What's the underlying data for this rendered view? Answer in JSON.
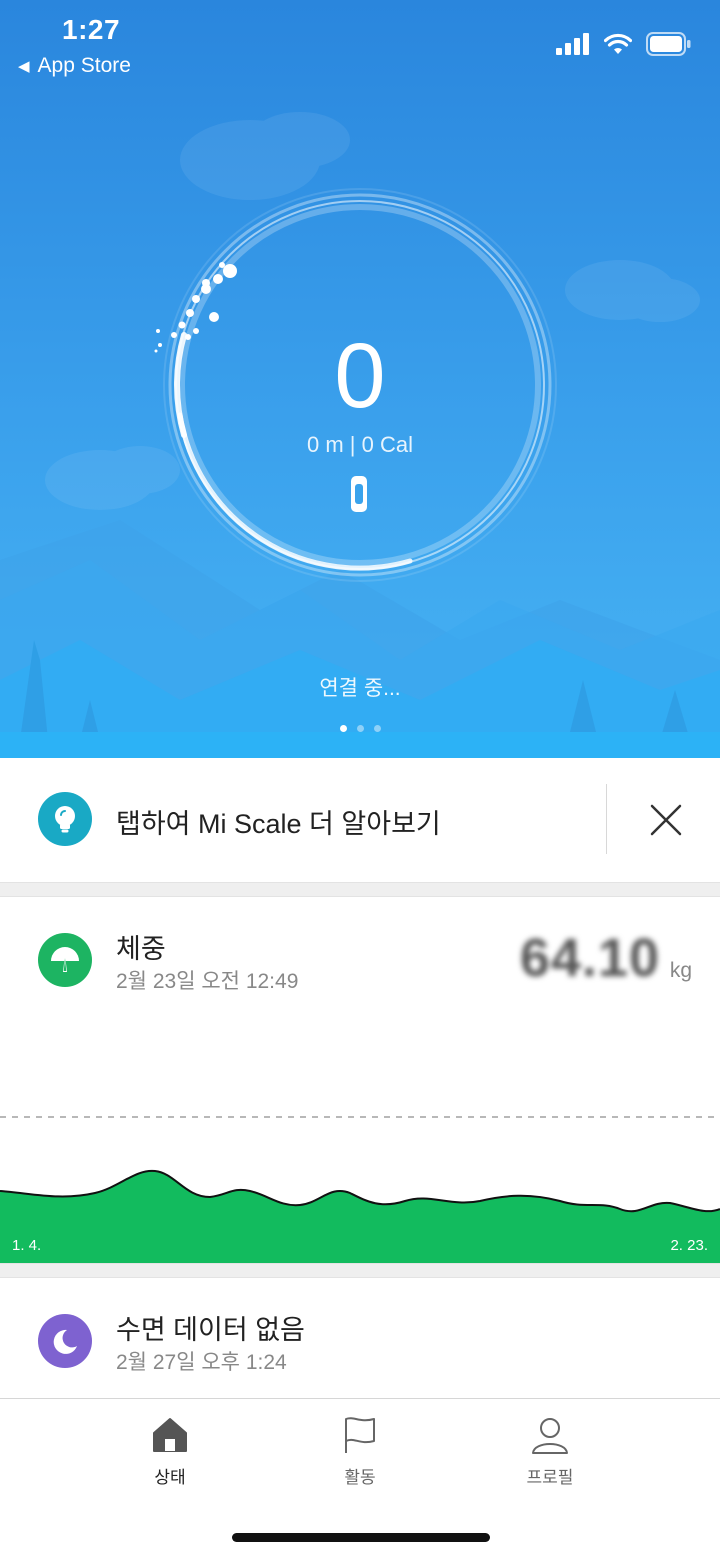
{
  "status_bar": {
    "time": "1:27",
    "back_label": "App Store"
  },
  "hero": {
    "steps": "0",
    "stats": "0 m | 0 Cal",
    "connection_status": "연결 중...",
    "page_count": 3,
    "active_page": 1
  },
  "tip_card": {
    "text": "탭하여 Mi Scale 더 알아보기"
  },
  "weight_card": {
    "title": "체중",
    "date": "2월 23일 오전 12:49",
    "value": "64.10",
    "unit": "kg",
    "chart_start_label": "1. 4.",
    "chart_end_label": "2. 23."
  },
  "sleep_card": {
    "title": "수면 데이터 없음",
    "date": "2월 27일 오후 1:24"
  },
  "tabs": [
    {
      "label": "상태",
      "icon": "home-icon",
      "active": true
    },
    {
      "label": "활동",
      "icon": "flag-icon",
      "active": false
    },
    {
      "label": "프로필",
      "icon": "profile-icon",
      "active": false
    }
  ],
  "colors": {
    "hero_top": "#2a86dd",
    "hero_bottom": "#47b4f4",
    "tip_accent": "#19a9c5",
    "weight_accent": "#1db462",
    "sleep_accent": "#7e62d0"
  }
}
